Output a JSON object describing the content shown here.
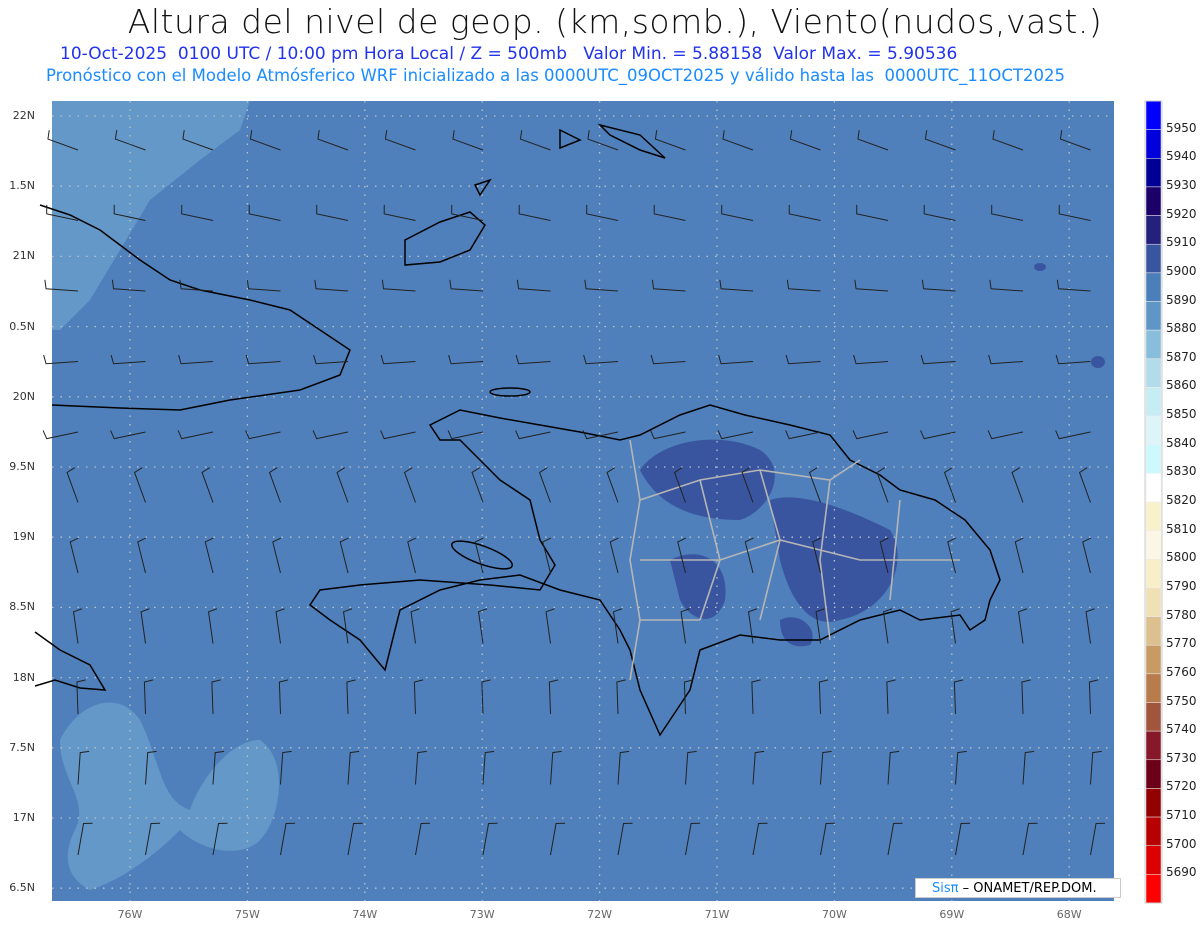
{
  "header": {
    "title": "Altura del nivel de geop. (km,somb.), Viento(nudos,vast.)",
    "subtitle": "10-Oct-2025  0100 UTC / 10:00 pm Hora Local / Z = 500mb   Valor Min. = 5.88158  Valor Max. = 5.90536",
    "model_info": "Pronóstico con el Modelo Atmósferico WRF inicializado a las 0000UTC_09OCT2025 y válido hasta las  0000UTC_11OCT2025"
  },
  "map": {
    "background_color": "#4f80bb",
    "y_axis_labels": [
      "22N",
      "1.5N",
      "21N",
      "0.5N",
      "20N",
      "9.5N",
      "19N",
      "8.5N",
      "18N",
      "7.5N",
      "17N",
      "6.5N"
    ],
    "x_axis_labels": [
      "76W",
      "75W",
      "74W",
      "73W",
      "72W",
      "71W",
      "70W",
      "69W",
      "68W"
    ]
  },
  "colorbar": {
    "labels": [
      "5950",
      "5940",
      "5930",
      "5920",
      "5910",
      "5900",
      "5890",
      "5880",
      "5870",
      "5860",
      "5850",
      "5840",
      "5830",
      "5820",
      "5810",
      "5800",
      "5790",
      "5780",
      "5770",
      "5760",
      "5750",
      "5740",
      "5730",
      "5720",
      "5710",
      "5700",
      "5690"
    ],
    "colors": [
      "#0000ff",
      "#0000dc",
      "#000096",
      "#1a0068",
      "#24207c",
      "#3a55a0",
      "#4a7fba",
      "#5e96c8",
      "#88bddc",
      "#b2dcea",
      "#c6ecf4",
      "#ddf5f9",
      "#cdf9fc",
      "#ffffff",
      "#f8f1cc",
      "#fcf6e6",
      "#f8eec8",
      "#f0e0b6",
      "#dcc090",
      "#c89a64",
      "#b87c4c",
      "#a0553c",
      "#86182a",
      "#6c0018",
      "#920000",
      "#b80000",
      "#dc0000",
      "#ff0000"
    ]
  },
  "credit": {
    "brand": "Sisπ",
    "text": " –  ONAMET/REP.DOM."
  }
}
